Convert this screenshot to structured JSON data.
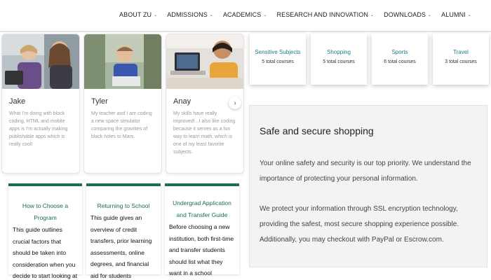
{
  "nav": {
    "items": [
      {
        "label": "ABOUT ZU",
        "chevron": true
      },
      {
        "label": "ADMISSIONS",
        "chevron": true
      },
      {
        "label": "ACADEMICS",
        "chevron": true
      },
      {
        "label": "RESEARCH AND INNOVATION",
        "chevron": true
      },
      {
        "label": "DOWNLOADS",
        "chevron": true
      },
      {
        "label": "ALUMNI",
        "chevron": true
      }
    ]
  },
  "testimonials": [
    {
      "name": "Jake",
      "quote": "What I'm doing with block coding, HTML and mobile apps is I'm actually making publishable apps which is really cool!"
    },
    {
      "name": "Tyler",
      "quote": "My teacher and I are coding a new space simulator comparing the gravities of black holes to Mars."
    },
    {
      "name": "Anay",
      "quote": "My skills have really improved!...I also like coding because it serves as a fun way to learn math, which is one of my least favorite subjects."
    }
  ],
  "carousel": {
    "next_icon": "chevron-right-icon",
    "next_glyph": "›"
  },
  "guides": [
    {
      "title": "How to Choose a Program",
      "body": "This guide outlines crucial factors that should be taken into consideration when you decide to start looking at psychology programs."
    },
    {
      "title": "Returning to School",
      "body": "This guide gives an overview of credit transfers, prior learning assessments, online degrees, and financial aid for students returning to school."
    },
    {
      "title": "Undergrad Application and Transfer Guide",
      "body": "Before choosing a new institution, both first-time and transfer students should list what they want in a school"
    }
  ],
  "categories": [
    {
      "name": "Sensitive Subjects",
      "count": "5 total courses"
    },
    {
      "name": "Shopping",
      "count": "5 total courses"
    },
    {
      "name": "Sports",
      "count": "6 total courses"
    },
    {
      "name": "Travel",
      "count": "3 total courses"
    }
  ],
  "shopping": {
    "title": "Safe and secure shopping",
    "p1": "Your online safety and security is our top priority. We understand the importance of protecting your personal information.",
    "p2": "We protect your information through SSL encryption technology, providing the safest, most secure shopping experience possible. Additionally, you may checkout with PayPal or Escrow.com."
  },
  "colors": {
    "accent": "#1e6b55",
    "category_link": "#1e7d8c",
    "panel_bg": "#f1f3f4"
  }
}
